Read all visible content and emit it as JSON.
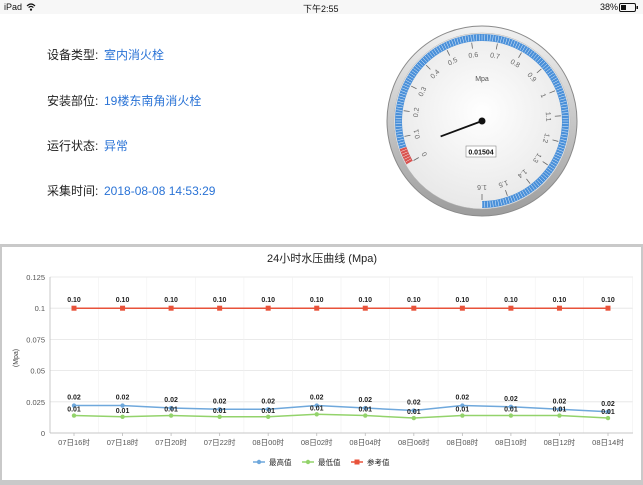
{
  "status_bar": {
    "device": "iPad",
    "time": "下午2:55",
    "battery": "38%"
  },
  "info": [
    {
      "label": "设备类型:",
      "value": "室内消火栓"
    },
    {
      "label": "安装部位:",
      "value": "19楼东南角消火栓"
    },
    {
      "label": "运行状态:",
      "value": "异常"
    },
    {
      "label": "采集时间:",
      "value": "2018-08-08 14:53:29"
    }
  ],
  "gauge": {
    "unit": "Mpa",
    "value": 0.01504,
    "value_label": "0.01504",
    "min": 0,
    "max": 1.6,
    "ticks": [
      "0",
      "0.1",
      "0.2",
      "0.3",
      "0.4",
      "0.5",
      "0.6",
      "0.7",
      "0.8",
      "0.9",
      "1",
      "1.1",
      "1.2",
      "1.3",
      "1.4",
      "1.5",
      "1.6"
    ],
    "band_color": "#4a90d9",
    "alarm_color": "#d9534f"
  },
  "chart_data": {
    "type": "line",
    "title": "24小时水压曲线 (Mpa)",
    "ylabel": "(Mpa)",
    "ylim": [
      0,
      0.125
    ],
    "yticks": [
      "0",
      "0.025",
      "0.05",
      "0.075",
      "0.1",
      "0.125"
    ],
    "categories": [
      "07日16时",
      "07日18时",
      "07日20时",
      "07日22时",
      "08日00时",
      "08日02时",
      "08日04时",
      "08日06时",
      "08日08时",
      "08日10时",
      "08日12时",
      "08日14时"
    ],
    "series": [
      {
        "name": "最高值",
        "color": "#6fa8dc",
        "values": [
          0.022,
          0.022,
          0.02,
          0.019,
          0.019,
          0.022,
          0.02,
          0.018,
          0.022,
          0.021,
          0.019,
          0.017
        ],
        "labels": [
          "0.02",
          "0.02",
          "0.02",
          "0.02",
          "0.02",
          "0.02",
          "0.02",
          "0.02",
          "0.02",
          "0.02",
          "0.02",
          "0.02"
        ]
      },
      {
        "name": "最低值",
        "color": "#93d36b",
        "values": [
          0.014,
          0.013,
          0.014,
          0.013,
          0.013,
          0.015,
          0.014,
          0.012,
          0.014,
          0.014,
          0.014,
          0.012
        ],
        "labels": [
          "0.01",
          "0.01",
          "0.01",
          "0.01",
          "0.01",
          "0.01",
          "0.01",
          "0.01",
          "0.01",
          "0.01",
          "0.01",
          "0.01"
        ]
      },
      {
        "name": "参考值",
        "color": "#e8523a",
        "values": [
          0.1,
          0.1,
          0.1,
          0.1,
          0.1,
          0.1,
          0.1,
          0.1,
          0.1,
          0.1,
          0.1,
          0.1
        ],
        "labels": [
          "0.10",
          "0.10",
          "0.10",
          "0.10",
          "0.10",
          "0.10",
          "0.10",
          "0.10",
          "0.10",
          "0.10",
          "0.10",
          "0.10"
        ]
      }
    ],
    "legend": "bottom-center",
    "grid": true
  }
}
